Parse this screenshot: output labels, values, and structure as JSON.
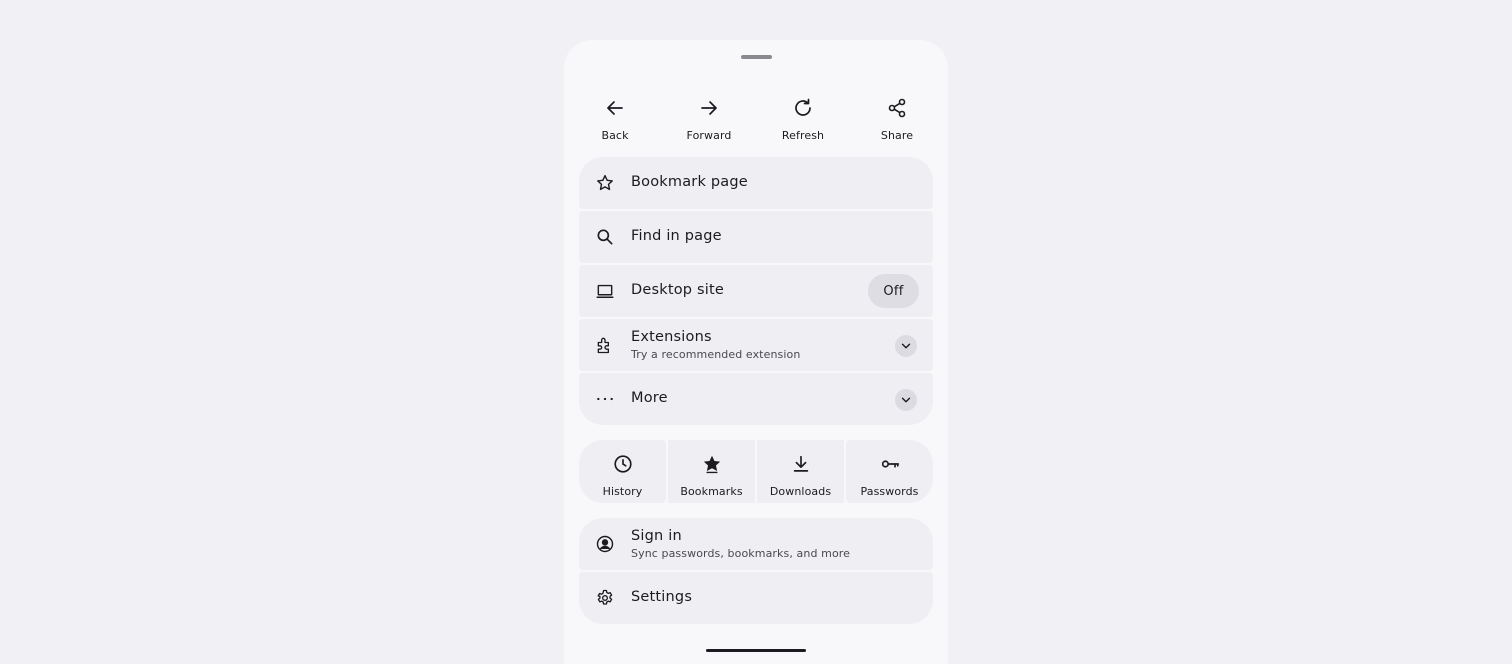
{
  "top_actions": [
    {
      "label": "Back",
      "icon": "arrow-left-icon"
    },
    {
      "label": "Forward",
      "icon": "arrow-right-icon"
    },
    {
      "label": "Refresh",
      "icon": "refresh-icon"
    },
    {
      "label": "Share",
      "icon": "share-icon"
    }
  ],
  "menu": {
    "bookmark_page": "Bookmark page",
    "find_in_page": "Find in page",
    "desktop_site": {
      "label": "Desktop site",
      "state": "Off"
    },
    "extensions": {
      "label": "Extensions",
      "subtitle": "Try a recommended extension"
    },
    "more": "More"
  },
  "quick_links": [
    {
      "label": "History",
      "icon": "clock-icon"
    },
    {
      "label": "Bookmarks",
      "icon": "star-filled-icon"
    },
    {
      "label": "Downloads",
      "icon": "download-icon"
    },
    {
      "label": "Passwords",
      "icon": "key-icon"
    }
  ],
  "account": {
    "sign_in": {
      "label": "Sign in",
      "subtitle": "Sync passwords, bookmarks, and more"
    },
    "settings": "Settings"
  }
}
